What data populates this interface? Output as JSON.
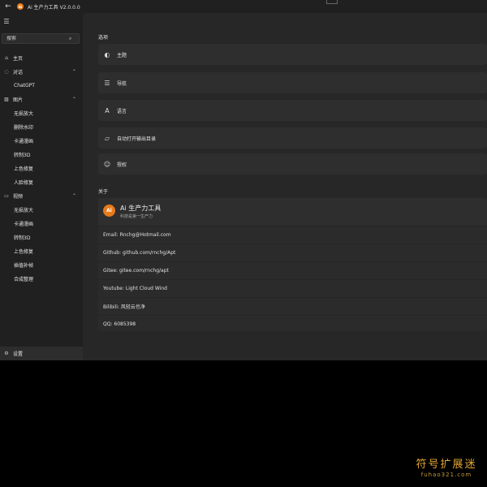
{
  "window": {
    "title": "Ai 生产力工具 V2.0.0.0",
    "logo_text": "Ai"
  },
  "icons": {
    "back": "back-arrow-icon",
    "menu": "hamburger-icon",
    "search": "search-icon"
  },
  "sidebar": {
    "search_placeholder": "搜索",
    "items": [
      {
        "label": "主页",
        "icon": "⌂",
        "top": 0
      },
      {
        "label": "对话",
        "icon": "◌",
        "chev": "⌃"
      },
      {
        "label": "ChatGPT"
      },
      {
        "label": "图片",
        "icon": "▨",
        "chev": "⌃"
      },
      {
        "label": "无损放大"
      },
      {
        "label": "删除水印"
      },
      {
        "label": "卡通漫画"
      },
      {
        "label": "转制3D"
      },
      {
        "label": "上色修复"
      },
      {
        "label": "人脸修复"
      },
      {
        "label": "视频",
        "icon": "▭",
        "chev": "⌃"
      },
      {
        "label": "无损放大"
      },
      {
        "label": "卡通漫画"
      },
      {
        "label": "转制3D"
      },
      {
        "label": "上色修复"
      },
      {
        "label": "插值补帧"
      },
      {
        "label": "合成整理"
      }
    ],
    "settings_label": "设置"
  },
  "main": {
    "options_title": "选项",
    "options": [
      {
        "label": "主题",
        "icon": "◐"
      },
      {
        "label": "导航",
        "icon": "☰"
      },
      {
        "label": "语言",
        "icon": "A"
      },
      {
        "label": "自动打开输出目录",
        "icon": "▱"
      },
      {
        "label": "授权",
        "icon": "☺"
      }
    ],
    "about_title": "关于",
    "about": {
      "logo_text": "Ai",
      "name": "Ai 生产力工具",
      "subtitle": "科技是第一生产力",
      "rows": [
        "Email: Rnchg@Hotmail.com",
        "Github: github.com/rnchg/Apt",
        "Gitee: gitee.com/rnchg/apt",
        "Youtube: Light Cloud Wind",
        "Bilibili: 风轻云也净",
        "QQ: 6085398"
      ]
    }
  },
  "watermark": {
    "cn": "符号扩展迷",
    "en": "fuhao321.com"
  },
  "colors": {
    "accent": "#e87a1c",
    "watermark": "#e2a530"
  }
}
